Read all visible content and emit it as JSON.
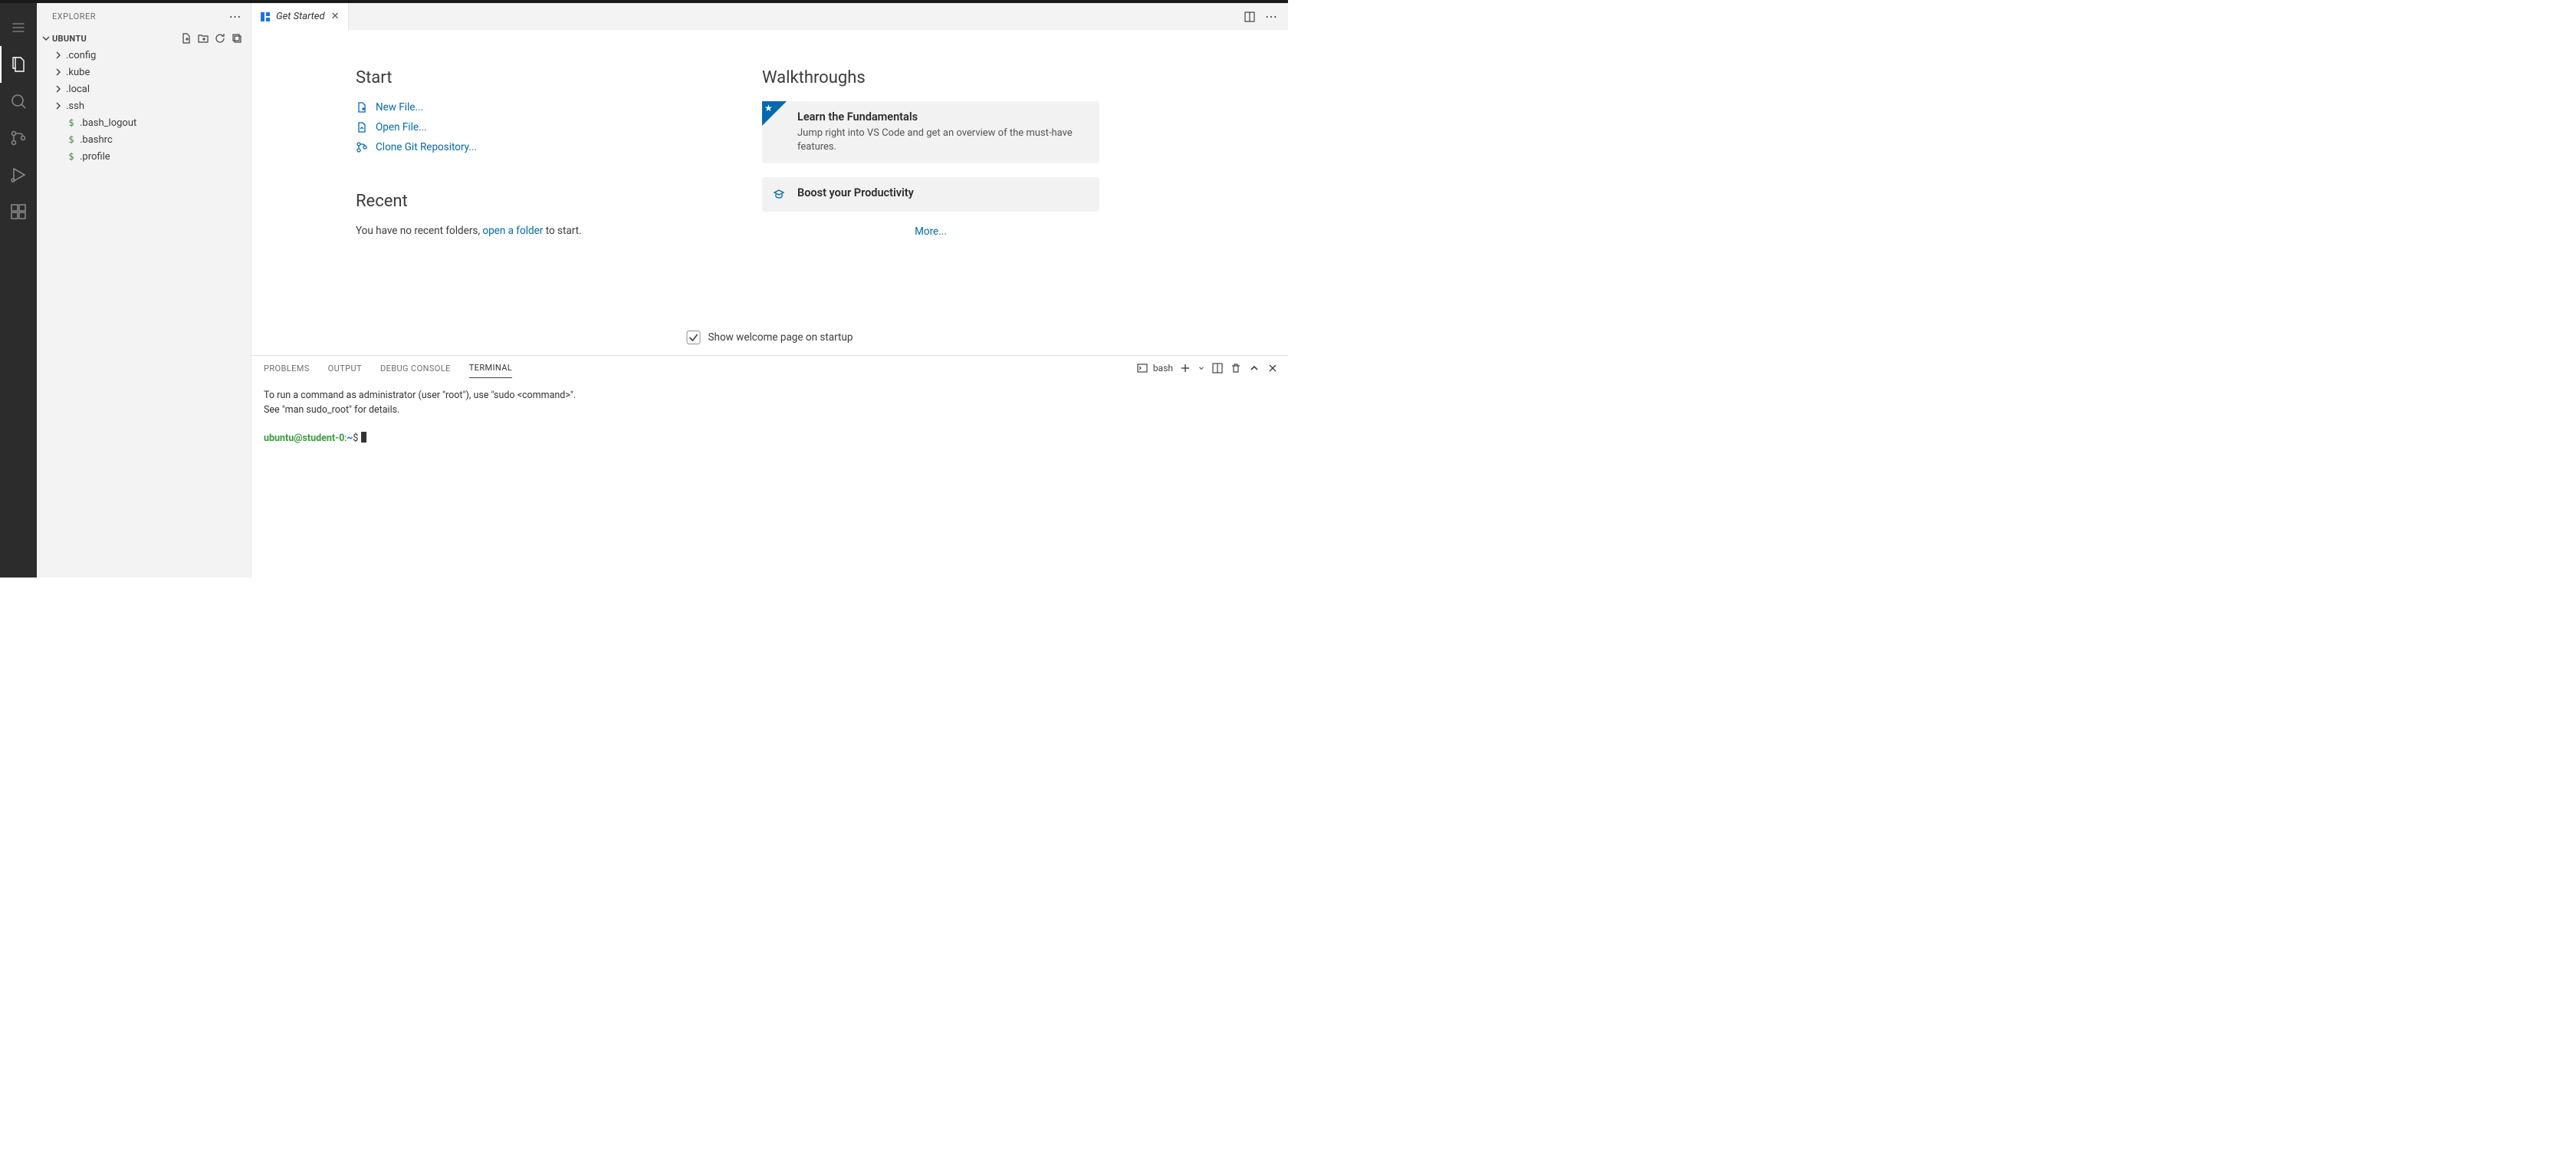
{
  "sidebar": {
    "title": "EXPLORER",
    "root": "UBUNTU",
    "items": [
      {
        "type": "folder",
        "label": ".config"
      },
      {
        "type": "folder",
        "label": ".kube"
      },
      {
        "type": "folder",
        "label": ".local"
      },
      {
        "type": "folder",
        "label": ".ssh"
      },
      {
        "type": "file",
        "label": ".bash_logout"
      },
      {
        "type": "file",
        "label": ".bashrc"
      },
      {
        "type": "file",
        "label": ".profile"
      }
    ]
  },
  "tab": {
    "label": "Get Started"
  },
  "welcome": {
    "start_title": "Start",
    "start_links": {
      "new_file": "New File...",
      "open_file": "Open File...",
      "clone_repo": "Clone Git Repository..."
    },
    "recent_title": "Recent",
    "recent_prefix": "You have no recent folders, ",
    "recent_link": "open a folder",
    "recent_suffix": " to start.",
    "walk_title": "Walkthroughs",
    "walk1_title": "Learn the Fundamentals",
    "walk1_desc": "Jump right into VS Code and get an overview of the must-have features.",
    "walk2_title": "Boost your Productivity",
    "more": "More...",
    "show_welcome": "Show welcome page on startup"
  },
  "panel": {
    "tabs": {
      "problems": "PROBLEMS",
      "output": "OUTPUT",
      "debug": "DEBUG CONSOLE",
      "terminal": "TERMINAL"
    },
    "shell": "bash",
    "term_line1": "To run a command as administrator (user \"root\"), use \"sudo <command>\".",
    "term_line2": "See \"man sudo_root\" for details.",
    "prompt_userhost": "ubuntu@student-0",
    "prompt_sep": ":",
    "prompt_path": "~",
    "prompt_sym": "$"
  }
}
